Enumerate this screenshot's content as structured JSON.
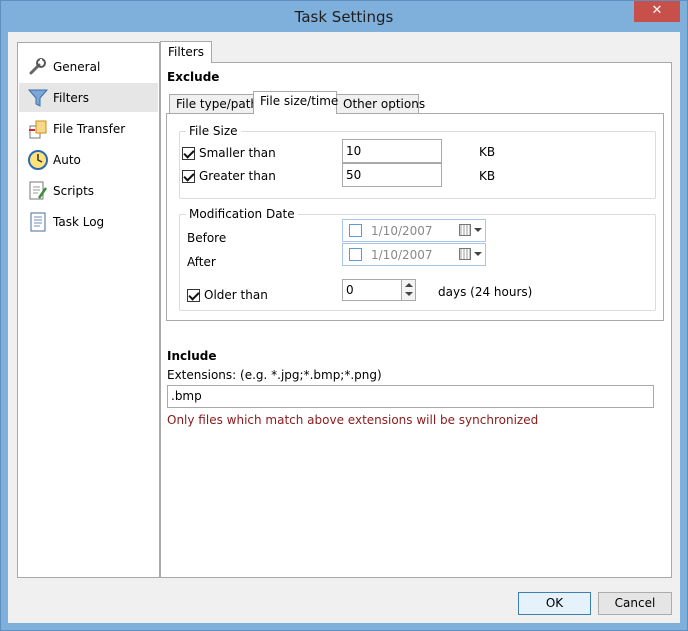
{
  "window": {
    "title": "Task Settings",
    "close_glyph": "✕"
  },
  "sidebar": {
    "items": [
      {
        "label": "General",
        "icon": "wrench-icon"
      },
      {
        "label": "Filters",
        "icon": "funnel-icon",
        "selected": true
      },
      {
        "label": "File Transfer",
        "icon": "file-transfer-icon"
      },
      {
        "label": "Auto",
        "icon": "clock-icon"
      },
      {
        "label": "Scripts",
        "icon": "script-icon"
      },
      {
        "label": "Task Log",
        "icon": "log-icon"
      }
    ]
  },
  "main": {
    "tab_label": "Filters",
    "exclude_heading": "Exclude",
    "subtabs": [
      "File type/path",
      "File size/time",
      "Other options"
    ],
    "active_subtab": 1,
    "file_size": {
      "group_label": "File Size",
      "smaller_label": "Smaller than",
      "smaller_checked": true,
      "smaller_value": "10",
      "smaller_unit": "KB",
      "greater_label": "Greater than",
      "greater_checked": true,
      "greater_value": "50",
      "greater_unit": "KB"
    },
    "mod_date": {
      "group_label": "Modification Date",
      "before_label": "Before",
      "before_value": "1/10/2007",
      "after_label": "After",
      "after_value": "1/10/2007",
      "older_label": "Older than",
      "older_checked": true,
      "older_value": "0",
      "older_unit": "days (24 hours)"
    },
    "include_heading": "Include",
    "extensions_label": "Extensions: (e.g. *.jpg;*.bmp;*.png)",
    "extensions_value": ".bmp",
    "hint": "Only files which match above extensions will be synchronized"
  },
  "footer": {
    "ok_label": "OK",
    "cancel_label": "Cancel"
  },
  "colors": {
    "titlebar": "#7fb0dc",
    "close": "#c7504b",
    "hint": "#8b1a1a"
  }
}
